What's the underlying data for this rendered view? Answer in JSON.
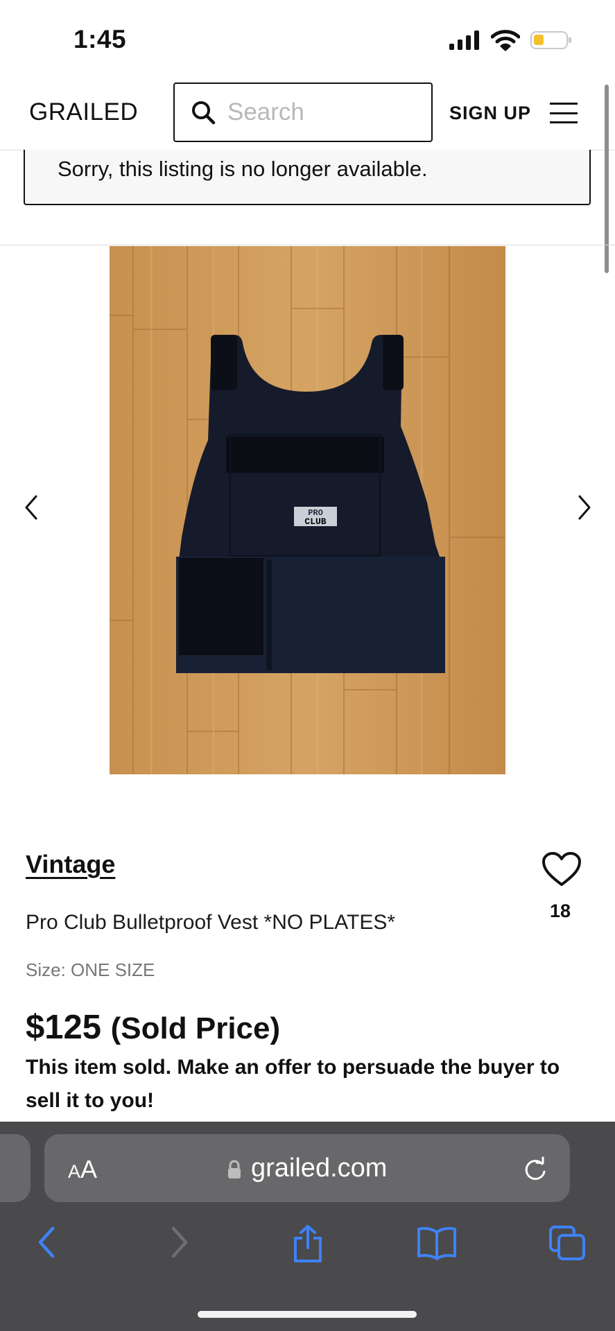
{
  "status_bar": {
    "time": "1:45",
    "battery_color": "#f4c12c"
  },
  "header": {
    "logo": "GRAILED",
    "search_placeholder": "Search",
    "signup_label": "SIGN UP",
    "menu_icon": "hamburger-menu-icon"
  },
  "notice": {
    "text": "Sorry, this listing is no longer available."
  },
  "gallery": {
    "prev_icon": "chevron-left-icon",
    "next_icon": "chevron-right-icon",
    "patch_top": "PRO",
    "patch_bottom": "CLUB"
  },
  "product": {
    "brand": "Vintage",
    "likes": "18",
    "title": "Pro Club Bulletproof Vest *NO PLATES*",
    "size": "Size: ONE SIZE",
    "price": "$125",
    "price_note": "(Sold Price)",
    "sold_message": "This item sold. Make an offer to persuade the buyer to sell it to you!"
  },
  "browser": {
    "text_size_label_small": "A",
    "text_size_label_large": "A",
    "domain": "grailed.com",
    "toolbar": [
      "back-icon",
      "forward-icon",
      "share-icon",
      "bookmarks-icon",
      "tabs-icon"
    ],
    "tint": "#3e82f7"
  }
}
